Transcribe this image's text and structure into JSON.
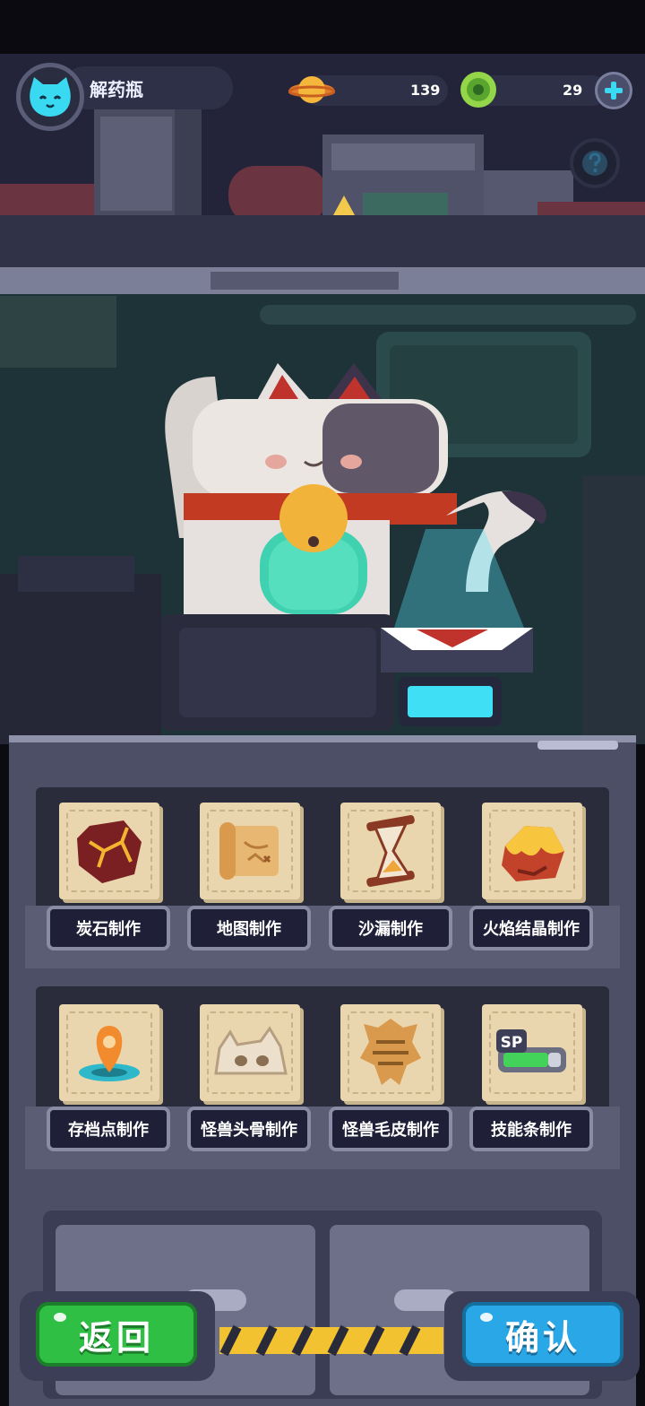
{
  "player": {
    "name": "解药瓶"
  },
  "resources": {
    "planet_coin": "139",
    "green_gem": "29"
  },
  "crafting": {
    "row1": [
      {
        "label": "炭石制作",
        "icon": "charcoal-stone-icon"
      },
      {
        "label": "地图制作",
        "icon": "map-scroll-icon"
      },
      {
        "label": "沙漏制作",
        "icon": "hourglass-icon"
      },
      {
        "label": "火焰结晶制作",
        "icon": "flame-crystal-icon"
      }
    ],
    "row2": [
      {
        "label": "存档点制作",
        "icon": "save-point-icon"
      },
      {
        "label": "怪兽头骨制作",
        "icon": "monster-skull-icon"
      },
      {
        "label": "怪兽毛皮制作",
        "icon": "monster-fur-icon"
      },
      {
        "label": "技能条制作",
        "icon": "skill-bar-icon"
      }
    ],
    "skill_bar_text": "SP"
  },
  "buttons": {
    "back": "返回",
    "confirm": "确认"
  },
  "colors": {
    "accent_cyan": "#39d9f2",
    "back_green": "#2fbf44",
    "confirm_blue": "#2aa7e6",
    "panel_dark": "#1f2037"
  }
}
